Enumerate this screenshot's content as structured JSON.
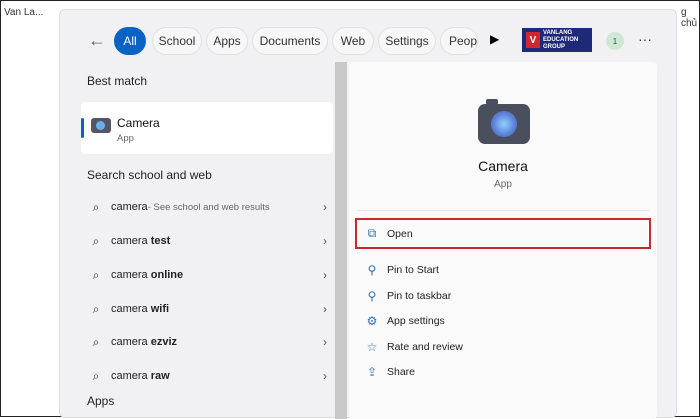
{
  "browser": {
    "bookmark_left": "Van La...",
    "bookmark_right": "g chủ"
  },
  "search": {
    "tabs": [
      "All",
      "School",
      "Apps",
      "Documents",
      "Web",
      "Settings",
      "Peop"
    ],
    "active_tab": "All",
    "org_logo": "VANLANG EDUCATION GROUP",
    "avatar_initial": "1"
  },
  "left": {
    "best_match_heading": "Best match",
    "best_match": {
      "title": "Camera",
      "subtitle": "App"
    },
    "web_heading": "Search school and web",
    "results": [
      {
        "term": "camera",
        "sub": " - See school and web results"
      },
      {
        "term": "camera ",
        "bold": "test"
      },
      {
        "term": "camera ",
        "bold": "online"
      },
      {
        "term": "camera ",
        "bold": "wifi"
      },
      {
        "term": "camera ",
        "bold": "ezviz"
      },
      {
        "term": "camera ",
        "bold": "raw"
      }
    ],
    "apps_heading": "Apps"
  },
  "right": {
    "title": "Camera",
    "subtitle": "App",
    "actions": [
      "Open",
      "Pin to Start",
      "Pin to taskbar",
      "App settings",
      "Rate and review",
      "Share"
    ]
  },
  "colors": {
    "accent": "#0a63c4",
    "highlight_box": "#c62a2f"
  }
}
